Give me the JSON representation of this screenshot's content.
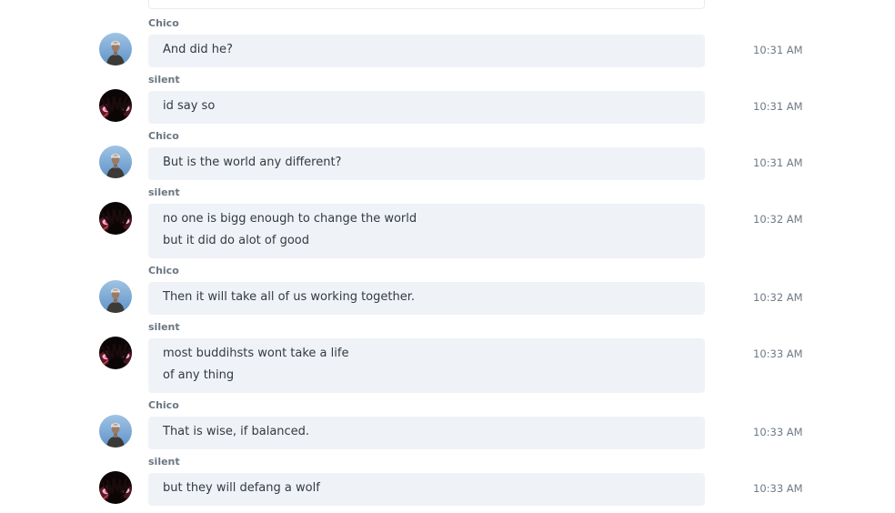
{
  "messages": [
    {
      "author": "Chico",
      "avatar": "chico-avatar",
      "lines": [
        "And did he?"
      ],
      "time": "10:31 AM"
    },
    {
      "author": "silent",
      "avatar": "silent-avatar",
      "lines": [
        "id say so"
      ],
      "time": "10:31 AM"
    },
    {
      "author": "Chico",
      "avatar": "chico-avatar",
      "lines": [
        "But is the world any different?"
      ],
      "time": "10:31 AM"
    },
    {
      "author": "silent",
      "avatar": "silent-avatar",
      "lines": [
        "no one is bigg enough to change the world",
        "but it did do alot of good"
      ],
      "time": "10:32 AM"
    },
    {
      "author": "Chico",
      "avatar": "chico-avatar",
      "lines": [
        "Then it will take all of us working together."
      ],
      "time": "10:32 AM"
    },
    {
      "author": "silent",
      "avatar": "silent-avatar",
      "lines": [
        "most buddihsts wont take a life",
        "of any thing"
      ],
      "time": "10:33 AM"
    },
    {
      "author": "Chico",
      "avatar": "chico-avatar",
      "lines": [
        "That is wise, if balanced."
      ],
      "time": "10:33 AM"
    },
    {
      "author": "silent",
      "avatar": "silent-avatar",
      "lines": [
        "but they will defang a wolf"
      ],
      "time": "10:33 AM"
    }
  ],
  "colors": {
    "bubble_bg": "#eff2f7",
    "name_text": "#6a7683",
    "message_text": "#333a40",
    "time_text": "#6f7a86"
  }
}
